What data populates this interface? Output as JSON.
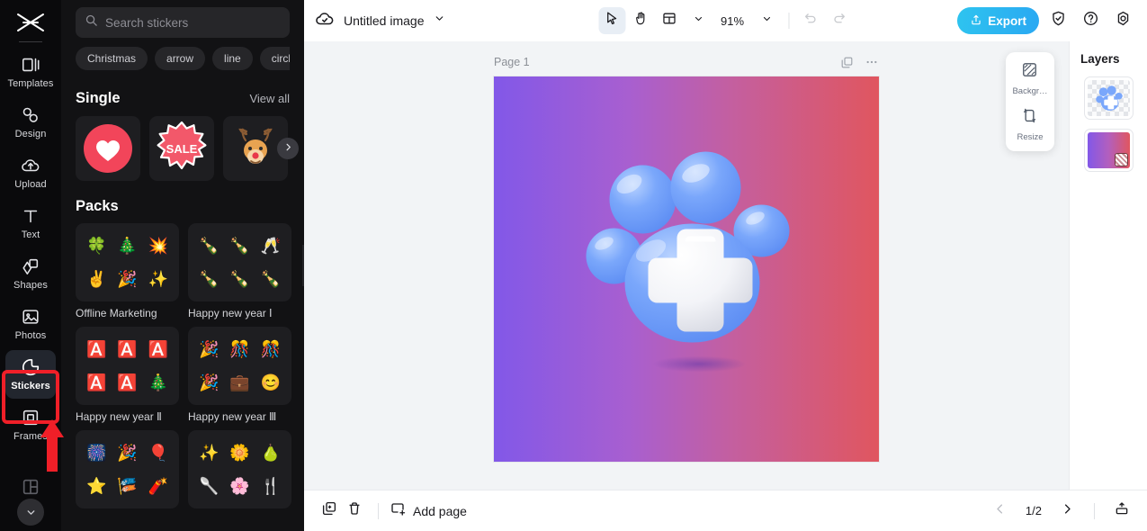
{
  "rail": {
    "logo_name": "capcut-logo",
    "items": [
      {
        "label": "Templates",
        "icon": "templates-icon",
        "active": false
      },
      {
        "label": "Design",
        "icon": "design-icon",
        "active": false
      },
      {
        "label": "Upload",
        "icon": "upload-cloud-icon",
        "active": false
      },
      {
        "label": "Text",
        "icon": "text-icon",
        "active": false
      },
      {
        "label": "Shapes",
        "icon": "shapes-icon",
        "active": false
      },
      {
        "label": "Photos",
        "icon": "photos-icon",
        "active": false
      },
      {
        "label": "Stickers",
        "icon": "stickers-icon",
        "active": true
      },
      {
        "label": "Frames",
        "icon": "frames-icon",
        "active": false
      }
    ],
    "more_icon": "grid-more-icon",
    "collapse_icon": "chevron-down-icon",
    "annotation_color": "#f01f28"
  },
  "panel": {
    "search": {
      "placeholder": "Search stickers",
      "value": "",
      "icon": "search-icon"
    },
    "chips": [
      "Christmas",
      "arrow",
      "line",
      "circle"
    ],
    "single": {
      "title": "Single",
      "view_all": "View all",
      "next_icon": "chevron-right-icon",
      "items": [
        {
          "name": "heart-sticker",
          "emoji": "❤"
        },
        {
          "name": "sale-burst-sticker",
          "text": "SALE"
        },
        {
          "name": "reindeer-sticker",
          "emoji": "🦌"
        }
      ]
    },
    "packs_title": "Packs",
    "packs": [
      {
        "name": "Offline Marketing",
        "emojis": [
          "🍀",
          "🎄",
          "💥",
          "✌️",
          "🎉",
          "✨"
        ]
      },
      {
        "name": "Happy new year Ⅰ",
        "emojis": [
          "🍾",
          "🍾",
          "🥂",
          "🍾",
          "🍾",
          "🍾"
        ]
      },
      {
        "name": "Happy new year Ⅱ",
        "emojis": [
          "🅰️",
          "🅰️",
          "🅰️",
          "🅰️",
          "🅰️",
          "🎄"
        ]
      },
      {
        "name": "Happy new year Ⅲ",
        "emojis": [
          "🎉",
          "🎊",
          "🎊",
          "🎉",
          "💼",
          "😊"
        ]
      },
      {
        "name": "",
        "emojis": [
          "🎆",
          "🎉",
          "🎈",
          "⭐",
          "🎏",
          "🧨"
        ]
      },
      {
        "name": "",
        "emojis": [
          "✨",
          "🌼",
          "🍐",
          "🥄",
          "🌸",
          "🍴"
        ]
      }
    ],
    "collapse_icon": "chevron-left-icon"
  },
  "topbar": {
    "cloud_icon": "cloud-saved-icon",
    "doc_title": "Untitled image",
    "title_chevron": "chevron-down-icon",
    "tools": [
      {
        "name": "select-tool",
        "icon": "cursor-arrow-icon",
        "selected": true
      },
      {
        "name": "hand-tool",
        "icon": "hand-icon",
        "selected": false
      },
      {
        "name": "layout-tool",
        "icon": "layout-icon",
        "selected": false
      }
    ],
    "layout_chevron": "chevron-down-icon",
    "zoom_level": "91%",
    "zoom_chevron": "chevron-down-icon",
    "undo_icon": "undo-icon",
    "redo_icon": "redo-icon",
    "export_label": "Export",
    "export_icon": "upload-icon",
    "export_color": "#2ab4f0",
    "shield_icon": "shield-check-icon",
    "help_icon": "help-circle-icon",
    "settings_icon": "settings-gear-icon"
  },
  "stage": {
    "page_label": "Page 1",
    "duplicate_icon": "duplicate-page-icon",
    "more_icon": "more-horizontal-icon",
    "canvas": {
      "gradient_from": "#8258e8",
      "gradient_to": "#e0565f",
      "artwork_name": "3d-blue-paw-with-cross"
    },
    "float_tools": [
      {
        "label": "Backgr…",
        "icon": "background-icon"
      },
      {
        "label": "Resize",
        "icon": "resize-icon"
      }
    ]
  },
  "layers": {
    "title": "Layers",
    "items": [
      {
        "name": "layer-paw-artwork",
        "kind": "image"
      },
      {
        "name": "layer-background",
        "kind": "gradient"
      }
    ]
  },
  "bottombar": {
    "duplicate_icon": "duplicate-icon",
    "delete_icon": "trash-icon",
    "add_page_label": "Add page",
    "add_page_icon": "add-page-icon",
    "prev_icon": "chevron-left-icon",
    "next_icon": "chevron-right-icon",
    "page_indicator": "1/2",
    "export_panel_icon": "panel-export-icon"
  }
}
